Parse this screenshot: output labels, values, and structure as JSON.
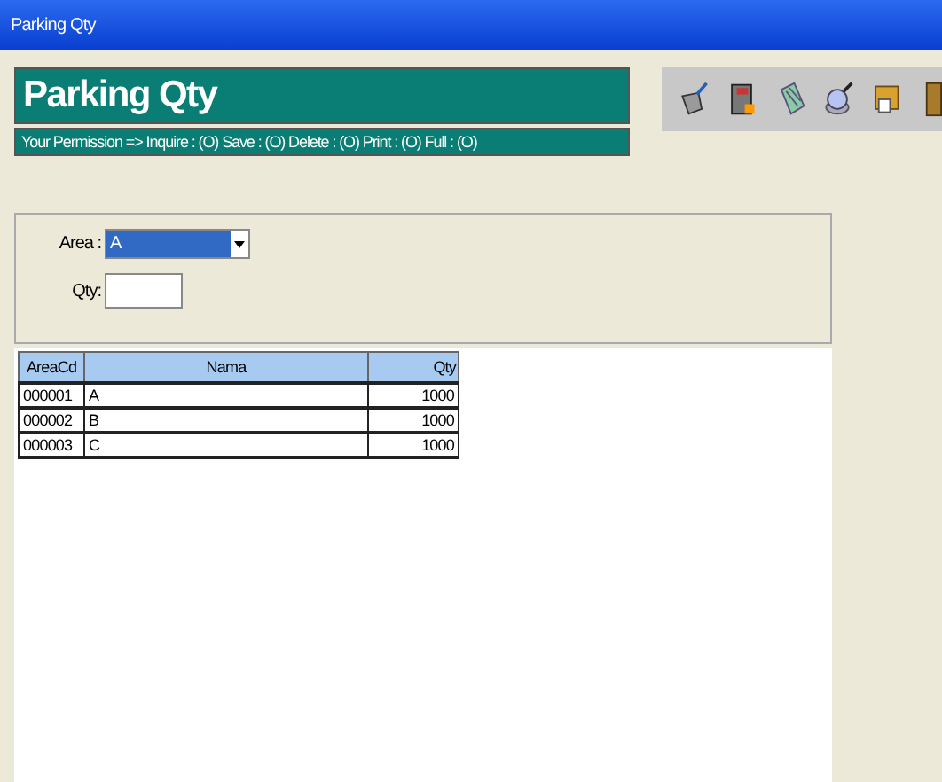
{
  "window": {
    "title": "Parking Qty"
  },
  "header": {
    "title": "Parking Qty",
    "permission": "Your Permission => Inquire : (O) Save : (O) Delete : (O) Print : (O) Full : (O)"
  },
  "toolbar": [
    {
      "kind": "clear"
    },
    {
      "kind": "save"
    },
    {
      "kind": "delete"
    },
    {
      "kind": "search"
    },
    {
      "kind": "print"
    },
    {
      "kind": "exit"
    }
  ],
  "form": {
    "area_label": "Area :",
    "area_value": "A",
    "qty_label": "Qty:"
  },
  "table": {
    "columns": [
      "AreaCd",
      "Nama",
      "Qty"
    ],
    "rows": [
      {
        "cells": [
          "000001",
          "A",
          "1000"
        ]
      },
      {
        "cells": [
          "000002",
          "B",
          "1000"
        ]
      },
      {
        "cells": [
          "000003",
          "C",
          "1000"
        ]
      }
    ]
  }
}
